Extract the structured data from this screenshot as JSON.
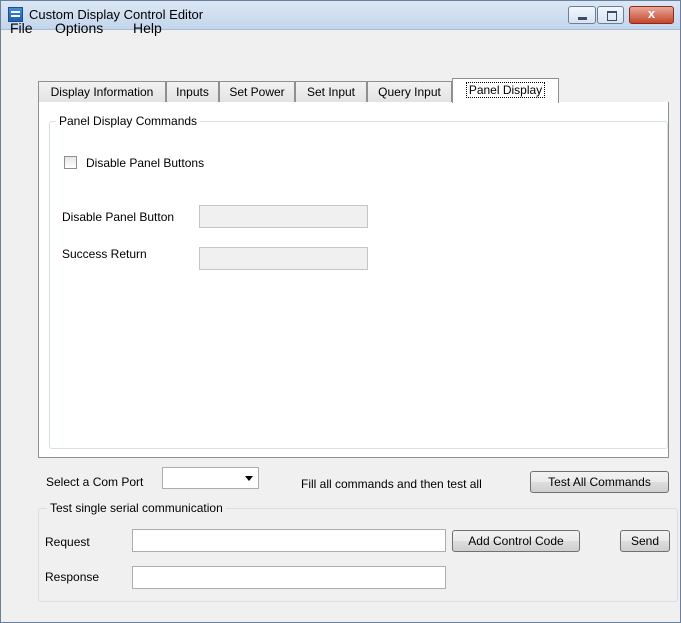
{
  "window": {
    "title": "Custom Display Control Editor",
    "close_glyph": "x"
  },
  "menu": {
    "items": [
      "File",
      "Options",
      "Help"
    ]
  },
  "tabs": {
    "items": [
      "Display Information",
      "Inputs",
      "Set Power",
      "Set Input",
      "Query Input",
      "Panel Display"
    ],
    "active": "Panel Display"
  },
  "panel": {
    "group_title": "Panel Display Commands",
    "disable_checkbox_label": "Disable Panel Buttons",
    "disable_checkbox_checked": false,
    "disable_button_label": "Disable Panel Button",
    "disable_button_value": "",
    "success_return_label": "Success Return",
    "success_return_value": ""
  },
  "com": {
    "select_label": "Select a Com Port",
    "selected_port": "",
    "fill_hint": "Fill all commands and then test all",
    "test_all_label": "Test All Commands"
  },
  "serial": {
    "group_title": "Test single serial communication",
    "request_label": "Request",
    "request_value": "",
    "add_control_code_label": "Add Control Code",
    "send_label": "Send",
    "response_label": "Response",
    "response_value": ""
  }
}
